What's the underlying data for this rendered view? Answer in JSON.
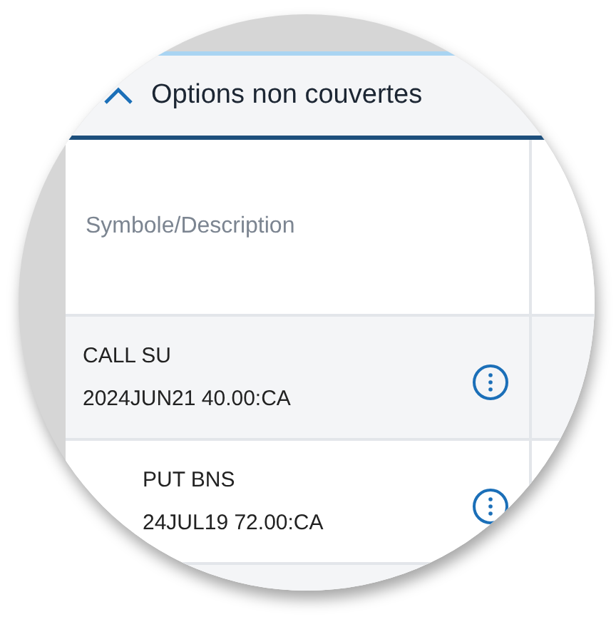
{
  "section": {
    "title": "Options non couvertes",
    "expanded": true
  },
  "search": {
    "placeholder": "Symbole/Description"
  },
  "rows": [
    {
      "symbol": "CALL SU",
      "detail": "2024JUN21 40.00:CA"
    },
    {
      "symbol": "PUT BNS",
      "detail": "24JUL19 72.00:CA"
    }
  ]
}
